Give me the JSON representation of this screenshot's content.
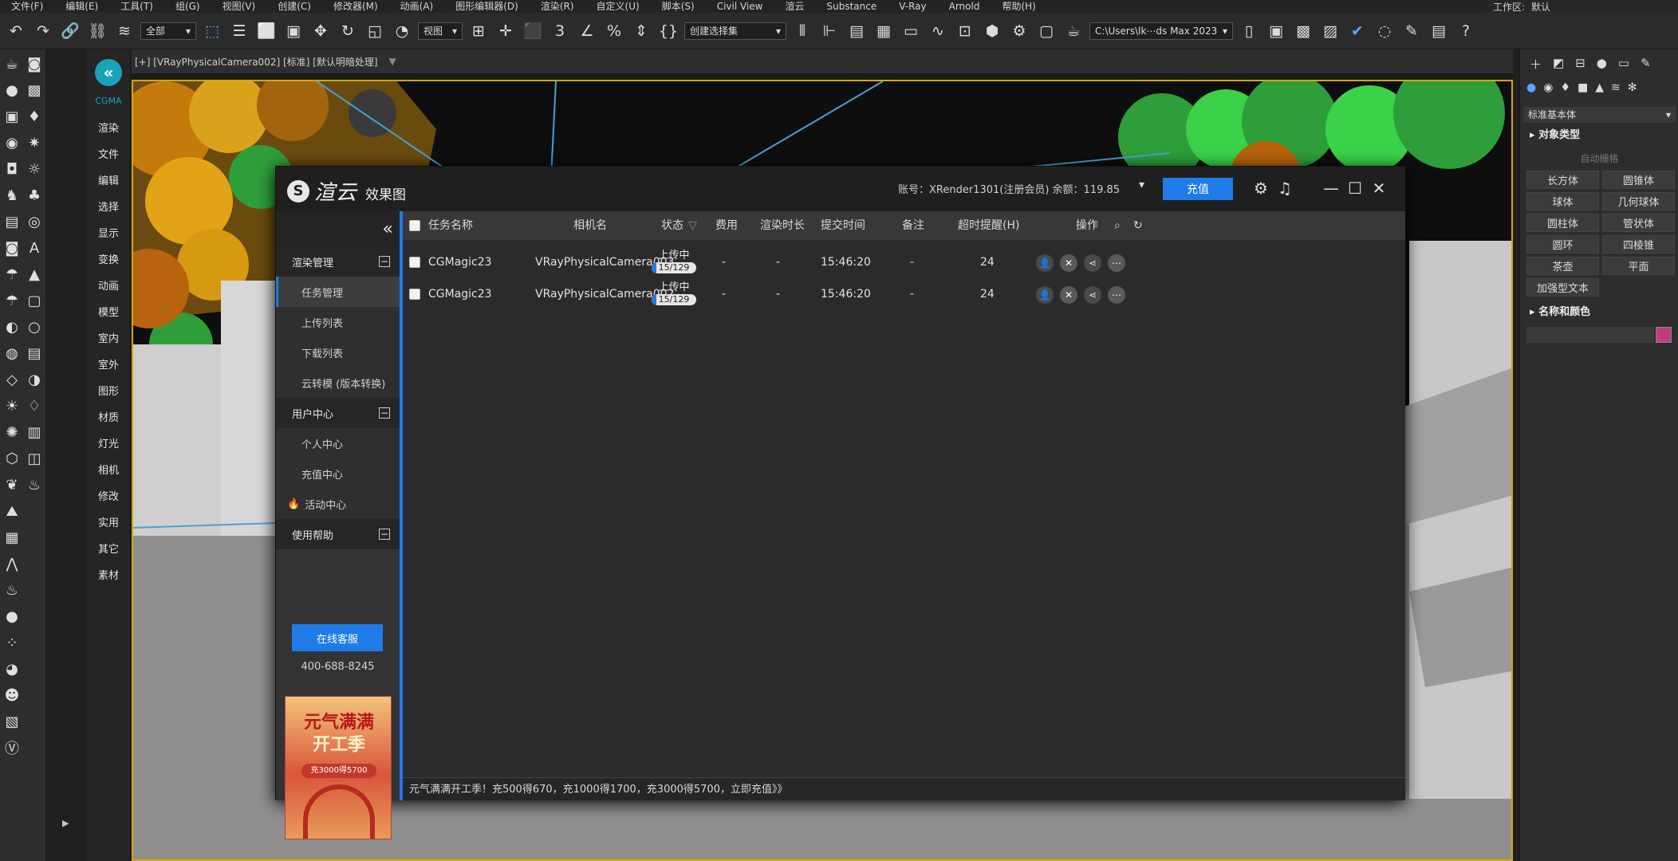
{
  "menubar": {
    "items": [
      "文件(F)",
      "编辑(E)",
      "工具(T)",
      "组(G)",
      "视图(V)",
      "创建(C)",
      "修改器(M)",
      "动画(A)",
      "图形编辑器(D)",
      "渲染(R)",
      "自定义(U)",
      "脚本(S)",
      "Civil View",
      "渲云",
      "Substance",
      "V-Ray",
      "Arnold",
      "帮助(H)"
    ],
    "workspace_label": "工作区:",
    "workspace_value": "默认"
  },
  "toolbar": {
    "filter_value": "全部",
    "view_value": "视图",
    "selection_set_placeholder": "创建选择集",
    "path_value": "C:\\Users\\lk⋯ds Max 2023"
  },
  "cg_sidebar": {
    "name": "CGMA",
    "items": [
      "渲染",
      "文件",
      "编辑",
      "选择",
      "显示",
      "变换",
      "动画",
      "模型",
      "室内",
      "室外",
      "图形",
      "材质",
      "灯光",
      "相机",
      "修改",
      "实用",
      "其它",
      "素材"
    ]
  },
  "viewport": {
    "label": "[+] [VRayPhysicalCamera002] [标准] [默认明暗处理]"
  },
  "right_panel": {
    "dropdown": "标准基本体",
    "section_object_type": "对象类型",
    "auto_grid": "自动栅格",
    "primitives": [
      "长方体",
      "圆锥体",
      "球体",
      "几何球体",
      "圆柱体",
      "管状体",
      "圆环",
      "四棱锥",
      "茶壶",
      "平面",
      "加强型文本"
    ],
    "section_name_color": "名称和颜色",
    "accent_color": "#c03c82"
  },
  "dialog": {
    "brand": "渲云",
    "product": "效果图",
    "account_text": "账号：XRender1301(注册会员)  余额：119.85",
    "charge_label": "充值",
    "sidebar": {
      "groups": [
        {
          "label": "渲染管理"
        },
        {
          "label": "用户中心"
        },
        {
          "label": "使用帮助"
        }
      ],
      "render_items": [
        "任务管理",
        "上传列表",
        "下载列表",
        "云转模 (版本转换)"
      ],
      "user_items": [
        "个人中心",
        "充值中心",
        "活动中心"
      ],
      "service_button": "在线客服",
      "phone": "400-688-8245",
      "ad": {
        "line1": "元气满满",
        "line2": "开工季",
        "line3": "充3000得5700"
      }
    },
    "table": {
      "headers": {
        "name": "任务名称",
        "camera": "相机名",
        "status": "状态",
        "cost": "费用",
        "duration": "渲染时长",
        "submit": "提交时间",
        "note": "备注",
        "timeout": "超时提醒(H)",
        "ops": "操作"
      },
      "rows": [
        {
          "name": "CGMagic23",
          "camera": "VRayPhysicalCamera003",
          "status": "上传中",
          "progress_text": "15/129",
          "progress": 0.116,
          "cost": "-",
          "duration": "-",
          "submit": "15:46:20",
          "note": "-",
          "timeout": "24"
        },
        {
          "name": "CGMagic23",
          "camera": "VRayPhysicalCamera002",
          "status": "上传中",
          "progress_text": "15/129",
          "progress": 0.116,
          "cost": "-",
          "duration": "-",
          "submit": "15:46:20",
          "note": "-",
          "timeout": "24"
        }
      ]
    },
    "footer": "元气满满开工季！充500得670，充1000得1700，充3000得5700，立即充值》》",
    "accent": "#1f7be8"
  }
}
